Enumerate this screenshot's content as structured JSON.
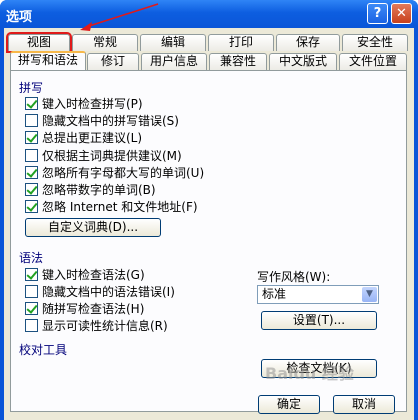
{
  "window": {
    "title": "选项",
    "help_glyph": "?",
    "close_glyph": "✕"
  },
  "tabs_top": [
    "视图",
    "常规",
    "编辑",
    "打印",
    "保存",
    "安全性"
  ],
  "tabs_bottom": [
    "拼写和语法",
    "修订",
    "用户信息",
    "兼容性",
    "中文版式",
    "文件位置"
  ],
  "spelling": {
    "header": "拼写",
    "options": [
      {
        "label": "键入时检查拼写(P)",
        "checked": true
      },
      {
        "label": "隐藏文档中的拼写错误(S)",
        "checked": false
      },
      {
        "label": "总提出更正建议(L)",
        "checked": true
      },
      {
        "label": "仅根据主词典提供建议(M)",
        "checked": false
      },
      {
        "label": "忽略所有字母都大写的单词(U)",
        "checked": true
      },
      {
        "label": "忽略带数字的单词(B)",
        "checked": true
      },
      {
        "label": "忽略 Internet 和文件地址(F)",
        "checked": true
      }
    ],
    "custom_dict_button": "自定义词典(D)..."
  },
  "grammar": {
    "header": "语法",
    "options": [
      {
        "label": "键入时检查语法(G)",
        "checked": true
      },
      {
        "label": "隐藏文档中的语法错误(I)",
        "checked": false
      },
      {
        "label": "随拼写检查语法(H)",
        "checked": true
      },
      {
        "label": "显示可读性统计信息(R)",
        "checked": false
      }
    ],
    "style_label": "写作风格(W):",
    "style_value": "标准",
    "settings_button": "设置(T)..."
  },
  "proofing": {
    "header": "校对工具",
    "recheck_button": "检查文档(K)"
  },
  "footer": {
    "ok": "确定",
    "cancel": "取消"
  },
  "watermark": "Baidu 经验"
}
